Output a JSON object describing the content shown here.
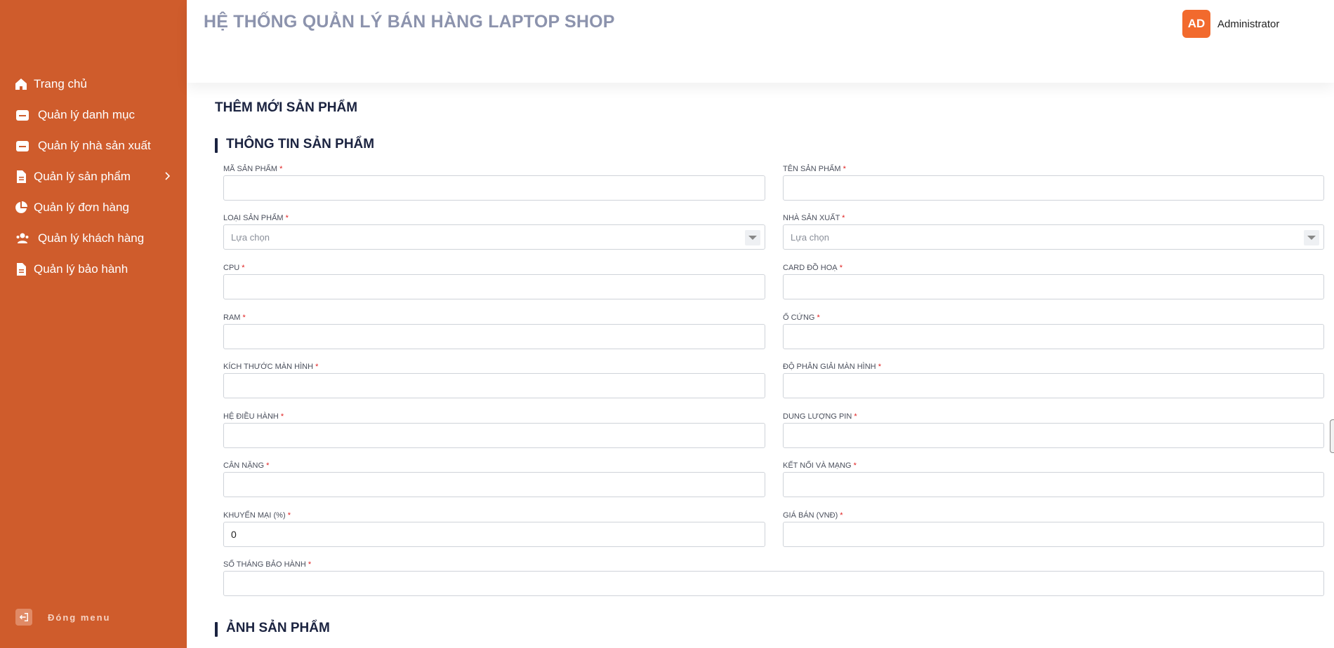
{
  "header": {
    "title": "HỆ THỐNG QUẢN LÝ BÁN HÀNG LAPTOP SHOP",
    "user": {
      "initials": "AD",
      "name": "Administrator"
    }
  },
  "sidebar": {
    "items": [
      {
        "label": "Trang chủ",
        "icon": "home-icon"
      },
      {
        "label": "Quản lý danh mục",
        "icon": "folder-icon"
      },
      {
        "label": "Quản lý nhà sản xuất",
        "icon": "folder-icon"
      },
      {
        "label": "Quản lý sản phẩm",
        "icon": "document-icon",
        "has_submenu": true
      },
      {
        "label": "Quản lý đơn hàng",
        "icon": "pie-chart-icon"
      },
      {
        "label": "Quản lý khách hàng",
        "icon": "users-icon"
      },
      {
        "label": "Quản lý bảo hành",
        "icon": "document-icon"
      }
    ],
    "close_label": "Đóng menu"
  },
  "page": {
    "title": "THÊM MỚI SẢN PHẨM",
    "section_info": "THÔNG TIN SẢN PHẨM",
    "section_images": "ẢNH SẢN PHẨM",
    "required_mark": "*"
  },
  "form": {
    "ma_san_pham": {
      "label": "MÃ SẢN PHẨM",
      "value": ""
    },
    "ten_san_pham": {
      "label": "TÊN SẢN PHẨM",
      "value": ""
    },
    "loai_san_pham": {
      "label": "LOẠI SẢN PHẨM",
      "value": "Lựa chọn"
    },
    "nha_san_xuat": {
      "label": "NHÀ SẢN XUẤT",
      "value": "Lựa chọn"
    },
    "cpu": {
      "label": "CPU",
      "value": ""
    },
    "card_do_hoa": {
      "label": "CARD ĐỒ HOẠ",
      "value": ""
    },
    "ram": {
      "label": "RAM",
      "value": ""
    },
    "o_cung": {
      "label": "Ổ CỨNG",
      "value": ""
    },
    "kich_thuoc_man_hinh": {
      "label": "KÍCH THƯỚC MÀN HÌNH",
      "value": ""
    },
    "do_phan_giai": {
      "label": "ĐỘ PHÂN GIẢI MÀN HÌNH",
      "value": ""
    },
    "he_dieu_hanh": {
      "label": "HỆ ĐIỀU HÀNH",
      "value": ""
    },
    "dung_luong_pin": {
      "label": "DUNG LƯỢNG PIN",
      "value": ""
    },
    "can_nang": {
      "label": "CÂN NẶNG",
      "value": ""
    },
    "ket_noi": {
      "label": "KẾT NỐI VÀ MẠNG",
      "value": ""
    },
    "khuyen_mai": {
      "label": "KHUYẾN MẠI (%)",
      "value": "0"
    },
    "gia_ban": {
      "label": "GIÁ BÁN (VNĐ)",
      "value": ""
    },
    "so_thang_bao_hanh": {
      "label": "SỐ THÁNG BẢO HÀNH",
      "value": ""
    }
  },
  "colors": {
    "sidebar": "#cf5c2c",
    "accent": "#f26a2d",
    "required": "#e02020"
  }
}
